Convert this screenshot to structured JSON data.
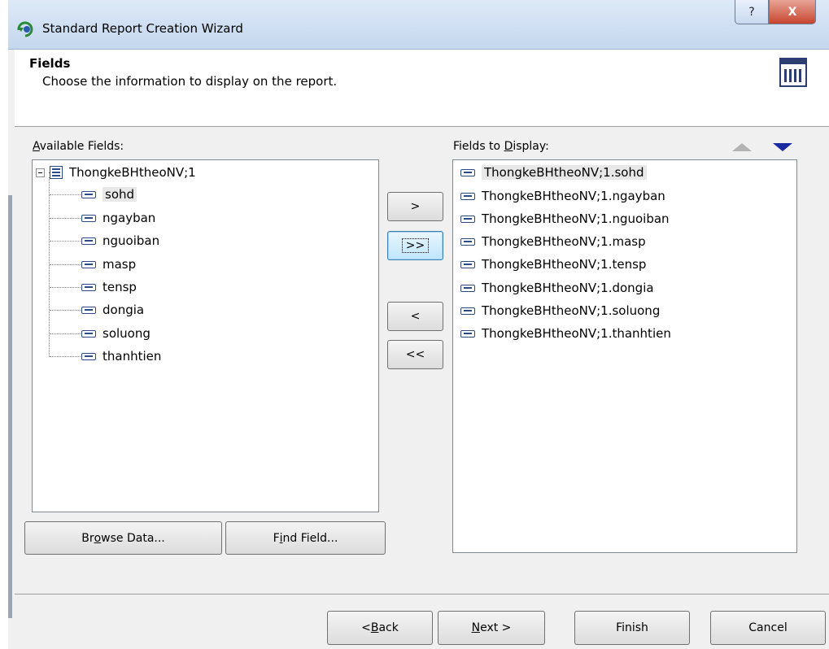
{
  "window": {
    "title": "Standard Report Creation Wizard",
    "help_label": "?",
    "close_label": "X"
  },
  "header": {
    "title": "Fields",
    "subtitle": "Choose the information to display on the report."
  },
  "available": {
    "label_pre": "",
    "label_key": "A",
    "label_post": "vailable Fields:",
    "root": "ThongkeBHtheoNV;1",
    "items": [
      {
        "label": "sohd"
      },
      {
        "label": "ngayban"
      },
      {
        "label": "nguoiban"
      },
      {
        "label": "masp"
      },
      {
        "label": "tensp"
      },
      {
        "label": "dongia"
      },
      {
        "label": "soluong"
      },
      {
        "label": "thanhtien"
      }
    ]
  },
  "display": {
    "label_pre": "Fields to ",
    "label_key": "D",
    "label_post": "isplay:",
    "items": [
      {
        "label": "ThongkeBHtheoNV;1.sohd"
      },
      {
        "label": "ThongkeBHtheoNV;1.ngayban"
      },
      {
        "label": "ThongkeBHtheoNV;1.nguoiban"
      },
      {
        "label": "ThongkeBHtheoNV;1.masp"
      },
      {
        "label": "ThongkeBHtheoNV;1.tensp"
      },
      {
        "label": "ThongkeBHtheoNV;1.dongia"
      },
      {
        "label": "ThongkeBHtheoNV;1.soluong"
      },
      {
        "label": "ThongkeBHtheoNV;1.thanhtien"
      }
    ]
  },
  "move_buttons": {
    "add": ">",
    "add_all": ">>",
    "remove": "<",
    "remove_all": "<<"
  },
  "browse_button": {
    "pre": "Br",
    "key": "o",
    "post": "wse Data..."
  },
  "find_button": {
    "pre": "F",
    "key": "i",
    "post": "nd Field..."
  },
  "footer": {
    "back": {
      "pre": "< ",
      "key": "B",
      "post": "ack"
    },
    "next": {
      "pre": "",
      "key": "N",
      "post": "ext >"
    },
    "finish": "Finish",
    "cancel": "Cancel"
  },
  "colors": {
    "accent_arrow": "#1a2aa0",
    "close": "#c8452f"
  }
}
